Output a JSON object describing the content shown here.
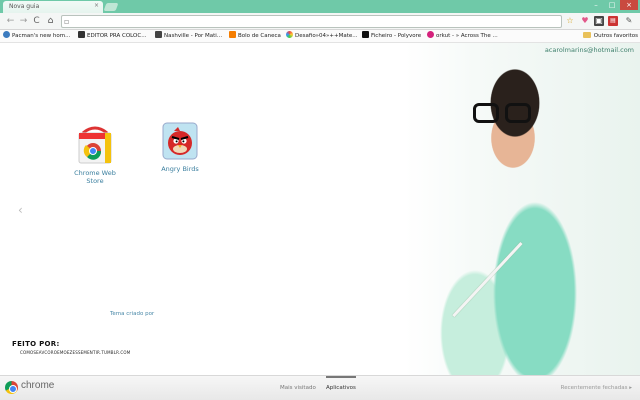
{
  "window": {
    "tab_title": "Nova guia",
    "tab_close": "×"
  },
  "toolbar": {
    "back": "←",
    "forward": "→",
    "reload": "C",
    "home": "⌂",
    "omnibox_value": "",
    "star": "☆"
  },
  "bookmarks": {
    "items": [
      {
        "label": "Pacman's new hom...",
        "color": "#3b7bbf"
      },
      {
        "label": "EDITOR PRA COLOC...",
        "color": "#333333"
      },
      {
        "label": "Nashville - Por Mati...",
        "color": "#444444"
      },
      {
        "label": "Bolo de Caneca",
        "color": "#f57d00"
      },
      {
        "label": "Desafio»04»++Mate...",
        "color": "#555555"
      },
      {
        "label": "Ficheiro - Polyvore",
        "color": "#111111"
      },
      {
        "label": "orkut - » Across The ...",
        "color": "#d4217c"
      }
    ],
    "other": "Outros favoritos"
  },
  "content": {
    "email": "acarolmarins@hotmail.com",
    "apps": [
      {
        "label": "Chrome Web Store"
      },
      {
        "label": "Angry Birds"
      }
    ],
    "arrow_left": "‹",
    "theme_credit": "Tema criado por",
    "feito_por": "FEITO POR:",
    "feito_url": "COMOSEAVCOROEMOEZESSEMENTIR.TUMBLR.COM"
  },
  "bottom": {
    "brand": "chrome",
    "tabs": [
      {
        "label": "Mais visitado",
        "active": false
      },
      {
        "label": "Aplicativos",
        "active": true
      }
    ],
    "recent": "Recentemente fechadas ▸"
  },
  "colors": {
    "frame": "#6fc9a8",
    "link": "#3b7f9f"
  }
}
